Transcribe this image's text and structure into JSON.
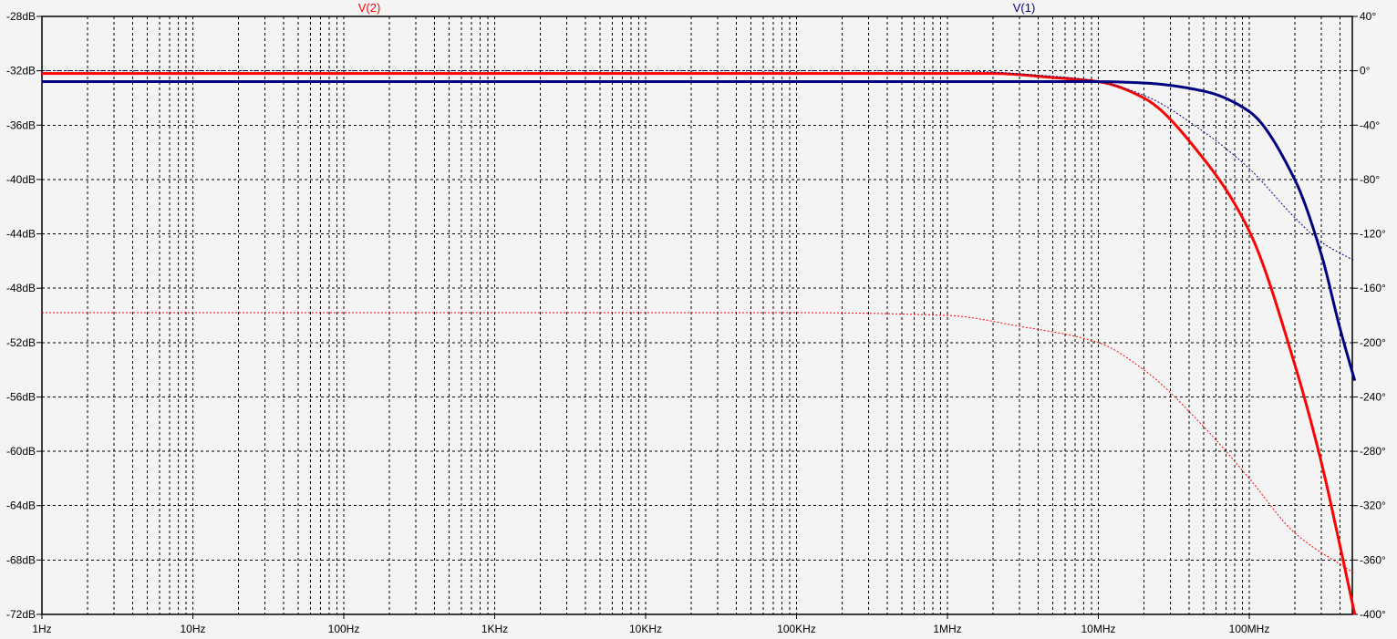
{
  "chart_data": {
    "type": "line",
    "title": "",
    "xscale": "log",
    "xlim_hz": [
      1,
      500000000
    ],
    "x_ticks": [
      {
        "value": 1,
        "label": "1Hz"
      },
      {
        "value": 10,
        "label": "10Hz"
      },
      {
        "value": 100,
        "label": "100Hz"
      },
      {
        "value": 1000,
        "label": "1KHz"
      },
      {
        "value": 10000,
        "label": "10KHz"
      },
      {
        "value": 100000,
        "label": "100KHz"
      },
      {
        "value": 1000000,
        "label": "1MHz"
      },
      {
        "value": 10000000,
        "label": "10MHz"
      },
      {
        "value": 100000000,
        "label": "100MHz"
      }
    ],
    "y_left": {
      "unit": "dB",
      "range": [
        -72,
        -28
      ],
      "ticks": [
        "-28dB",
        "-32dB",
        "-36dB",
        "-40dB",
        "-44dB",
        "-48dB",
        "-52dB",
        "-56dB",
        "-60dB",
        "-64dB",
        "-68dB",
        "-72dB"
      ]
    },
    "y_right": {
      "unit": "deg",
      "range": [
        -400,
        40
      ],
      "ticks": [
        "40°",
        "0°",
        "-40°",
        "-80°",
        "-120°",
        "-160°",
        "-200°",
        "-240°",
        "-280°",
        "-320°",
        "-360°",
        "-400°"
      ]
    },
    "grid": true,
    "series": [
      {
        "name": "V(2)",
        "color": "#ff0000",
        "magnitude_db": [
          [
            1,
            -32.2
          ],
          [
            1000000,
            -32.2
          ],
          [
            2000000,
            -32.2
          ],
          [
            5000000,
            -32.5
          ],
          [
            10000000,
            -32.8
          ],
          [
            20000000,
            -34.0
          ],
          [
            50000000,
            -38.5
          ],
          [
            100000000,
            -43.8
          ],
          [
            200000000,
            -53.6
          ],
          [
            300000000,
            -60.8
          ],
          [
            400000000,
            -67.0
          ],
          [
            500000000,
            -72.0
          ]
        ],
        "phase_deg": [
          [
            1,
            -178
          ],
          [
            100000,
            -178
          ],
          [
            1000000,
            -180
          ],
          [
            3000000,
            -188
          ],
          [
            10000000,
            -200
          ],
          [
            20000000,
            -220
          ],
          [
            50000000,
            -262
          ],
          [
            100000000,
            -300
          ],
          [
            200000000,
            -340
          ],
          [
            500000000,
            -370
          ]
        ]
      },
      {
        "name": "V(1)",
        "color": "#000080",
        "magnitude_db": [
          [
            1,
            -32.8
          ],
          [
            10000000,
            -32.8
          ],
          [
            20000000,
            -32.9
          ],
          [
            50000000,
            -33.5
          ],
          [
            100000000,
            -35.0
          ],
          [
            200000000,
            -40.0
          ],
          [
            300000000,
            -45.5
          ],
          [
            400000000,
            -51.0
          ],
          [
            500000000,
            -54.8
          ]
        ],
        "phase_deg": [
          [
            1,
            0
          ],
          [
            1000000,
            0
          ],
          [
            5000000,
            -4
          ],
          [
            10000000,
            -8
          ],
          [
            20000000,
            -18
          ],
          [
            50000000,
            -45
          ],
          [
            100000000,
            -72
          ],
          [
            200000000,
            -108
          ],
          [
            300000000,
            -126
          ],
          [
            500000000,
            -140
          ]
        ]
      }
    ]
  }
}
